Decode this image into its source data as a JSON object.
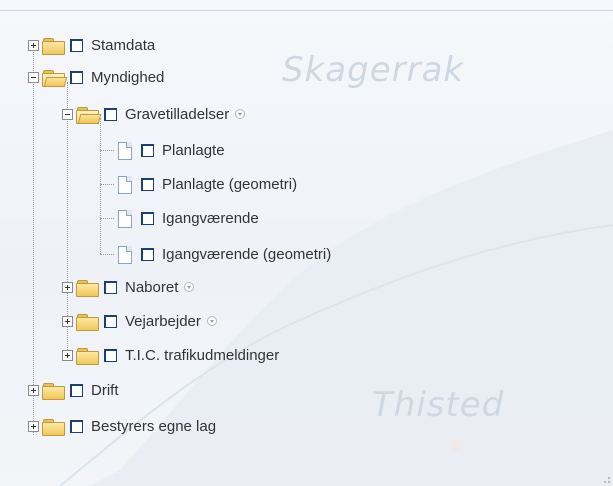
{
  "map": {
    "labels": [
      "Skagerrak",
      "Thisted"
    ]
  },
  "tree": {
    "items": [
      {
        "label": "Stamdata",
        "expanded": false,
        "checked": false,
        "level": 0,
        "type": "folder"
      },
      {
        "label": "Myndighed",
        "expanded": true,
        "checked": false,
        "level": 0,
        "type": "folder"
      },
      {
        "label": "Gravetilladelser",
        "expanded": true,
        "checked": false,
        "level": 1,
        "type": "folder",
        "info_icon": "info-icon"
      },
      {
        "label": "Planlagte",
        "checked": false,
        "level": 2,
        "type": "layer"
      },
      {
        "label": "Planlagte (geometri)",
        "checked": false,
        "level": 2,
        "type": "layer"
      },
      {
        "label": "Igangværende",
        "checked": false,
        "level": 2,
        "type": "layer"
      },
      {
        "label": "Igangværende (geometri)",
        "checked": false,
        "level": 2,
        "type": "layer"
      },
      {
        "label": "Naboret",
        "expanded": false,
        "checked": false,
        "level": 1,
        "type": "folder",
        "info_icon": "info-icon"
      },
      {
        "label": "Vejarbejder",
        "expanded": false,
        "checked": false,
        "level": 1,
        "type": "folder",
        "info_icon": "info-icon"
      },
      {
        "label": "T.I.C. trafikudmeldinger",
        "expanded": false,
        "checked": false,
        "level": 1,
        "type": "folder"
      },
      {
        "label": "Drift",
        "expanded": false,
        "checked": false,
        "level": 0,
        "type": "folder"
      },
      {
        "label": "Bestyrers egne lag",
        "expanded": false,
        "checked": false,
        "level": 0,
        "type": "folder"
      }
    ]
  },
  "colors": {
    "checkbox_border": "#1c3f78",
    "folder": "#f0c75a",
    "text": "#333333",
    "background": "#eef2f7"
  }
}
